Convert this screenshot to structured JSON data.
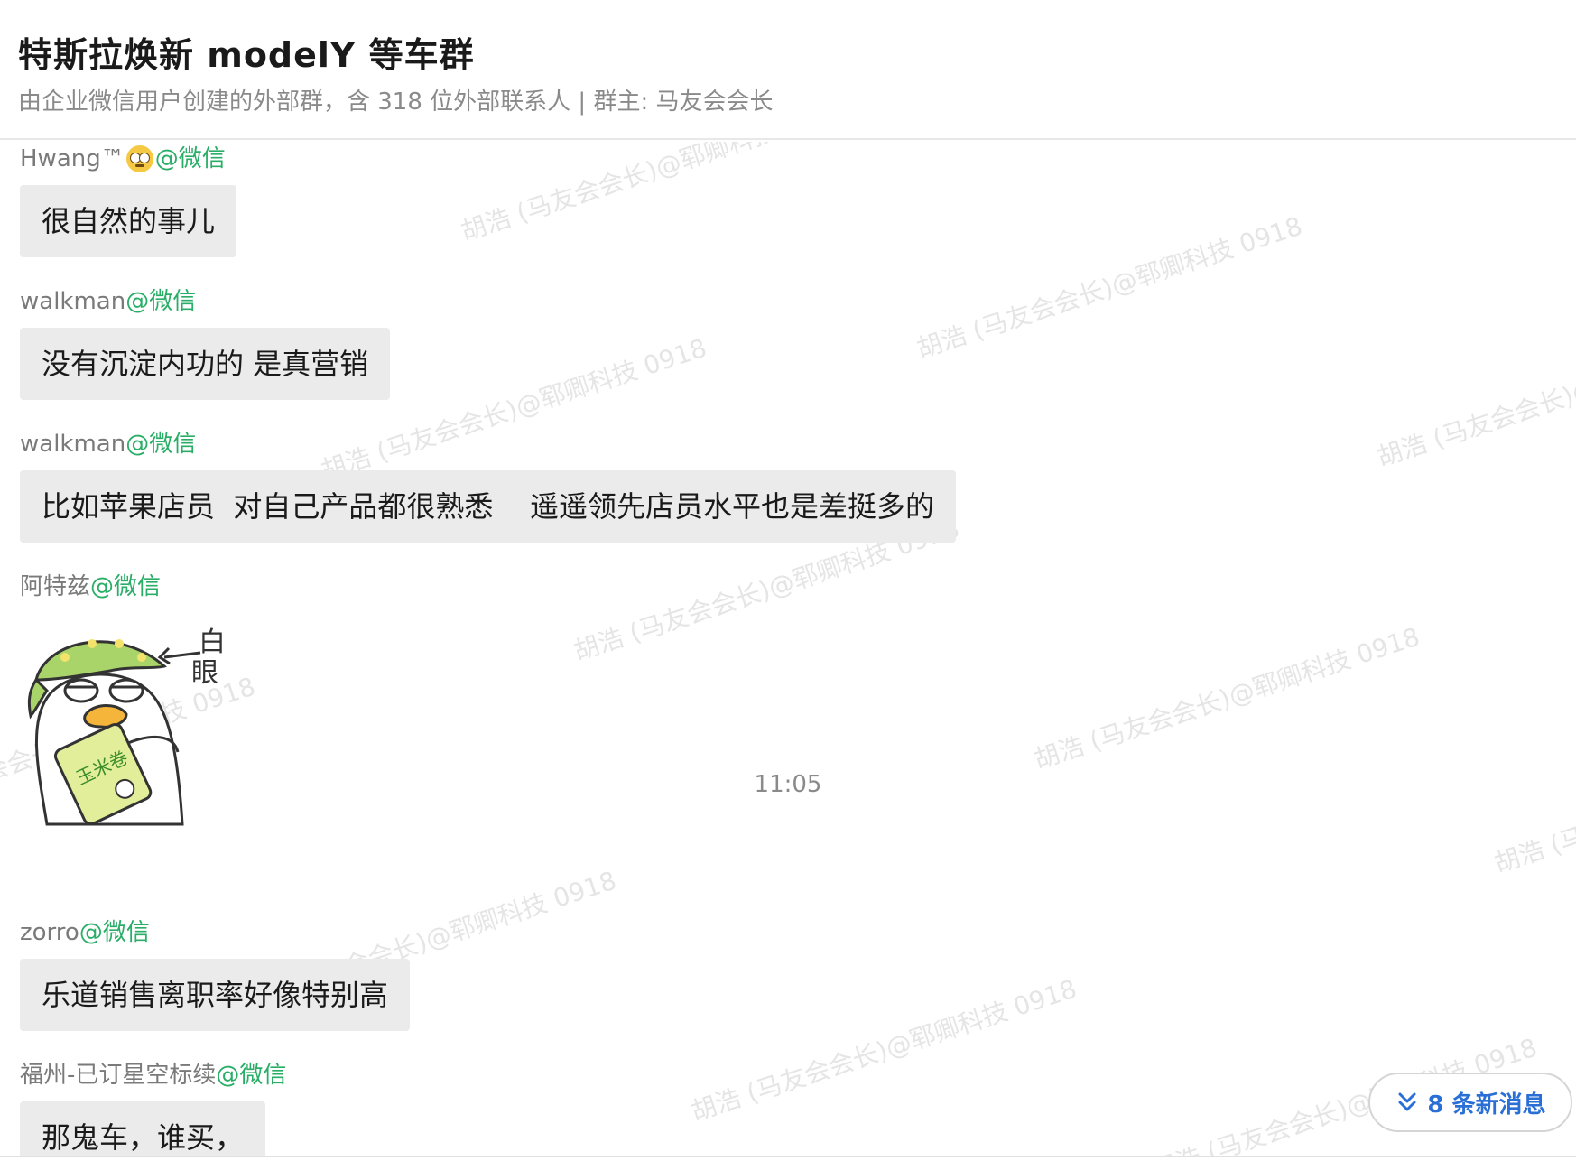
{
  "header": {
    "title": "特斯拉焕新 modelY 等车群",
    "subtitle": "由企业微信用户创建的外部群，含 318 位外部联系人 | 群主: 马友会会长"
  },
  "watermark_text": "胡浩 (马友会会长)@郓卿科技 0918",
  "messages": [
    {
      "sender": "Hwang™",
      "sender_suffix": "@微信",
      "text": "很自然的事儿"
    },
    {
      "sender": "walkman",
      "sender_suffix": "@微信",
      "text": "没有沉淀内功的 是真营销"
    },
    {
      "sender": "walkman",
      "sender_suffix": "@微信",
      "text": "比如苹果店员  对自己产品都很熟悉    遥遥领先店员水平也是差挺多的"
    },
    {
      "sender": "阿特兹",
      "sender_suffix": "@微信",
      "sticker": "duck-eye-roll-sticker",
      "sticker_text_1": "白",
      "sticker_text_2": "眼",
      "sticker_bag_text": "玉米卷"
    },
    {
      "sender": "zorro",
      "sender_suffix": "@微信",
      "text": "乐道销售离职率好像特别高"
    },
    {
      "sender": "福州-已订星空标续",
      "sender_suffix": "@微信",
      "text": "那鬼车，谁买，"
    }
  ],
  "time_divider": "11:05",
  "new_messages": {
    "label": "8 条新消息",
    "icon": "double-chevron-down-icon",
    "color": "#2a6fd6"
  },
  "colors": {
    "accent_green": "#2aae67",
    "bubble_bg": "#ebebeb",
    "text_gray": "#8a8a8a"
  }
}
